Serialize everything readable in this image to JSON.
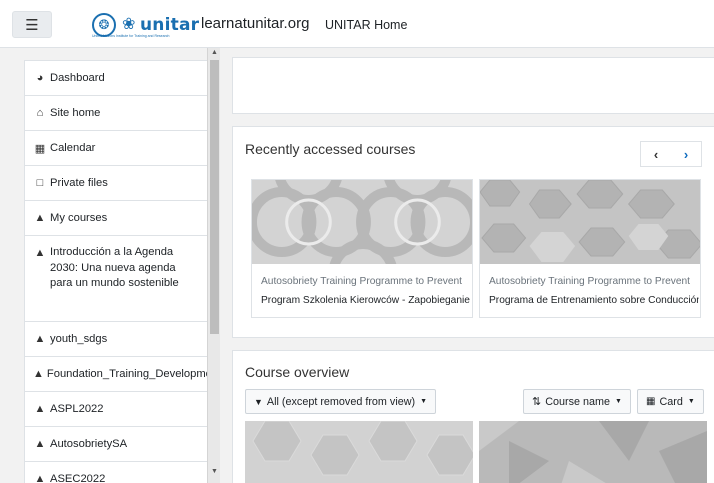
{
  "header": {
    "menu_icon": "hamburger-icon",
    "site_name": "learnatunitar.org",
    "home_link": "UNITAR Home",
    "logo_text": "unitar",
    "logo_subtitle": "United Nations Institute for Training and Research"
  },
  "sidebar": {
    "items": [
      {
        "label": "Dashboard",
        "icon": "dashboard-icon"
      },
      {
        "label": "Site home",
        "icon": "home-icon"
      },
      {
        "label": "Calendar",
        "icon": "calendar-icon"
      },
      {
        "label": "Private files",
        "icon": "file-icon"
      },
      {
        "label": "My courses",
        "icon": "graduation-cap-icon"
      },
      {
        "label": "Introducción a la Agenda 2030: Una nueva agenda para un mundo sostenible",
        "icon": "graduation-cap-icon"
      },
      {
        "label": "youth_sdgs",
        "icon": "graduation-cap-icon"
      },
      {
        "label": "Foundation_Training_Development",
        "icon": "graduation-cap-icon"
      },
      {
        "label": "ASPL2022",
        "icon": "graduation-cap-icon"
      },
      {
        "label": "AutosobrietySA",
        "icon": "graduation-cap-icon"
      },
      {
        "label": "ASEC2022",
        "icon": "graduation-cap-icon"
      }
    ]
  },
  "recent": {
    "title": "Recently accessed courses",
    "courses": [
      {
        "category": "Autosobriety Training Programme to Prevent",
        "name": "Program Szkolenia Kierowców - Zapobieganie"
      },
      {
        "category": "Autosobriety Training Programme to Prevent",
        "name": "Programa de Entrenamiento sobre Conducción"
      }
    ]
  },
  "overview": {
    "title": "Course overview",
    "filter_label": "All (except removed from view)",
    "sort_label": "Course name",
    "view_label": "Card"
  },
  "colors": {
    "accent": "#0f6cbf",
    "brand": "#1a6fb0"
  }
}
